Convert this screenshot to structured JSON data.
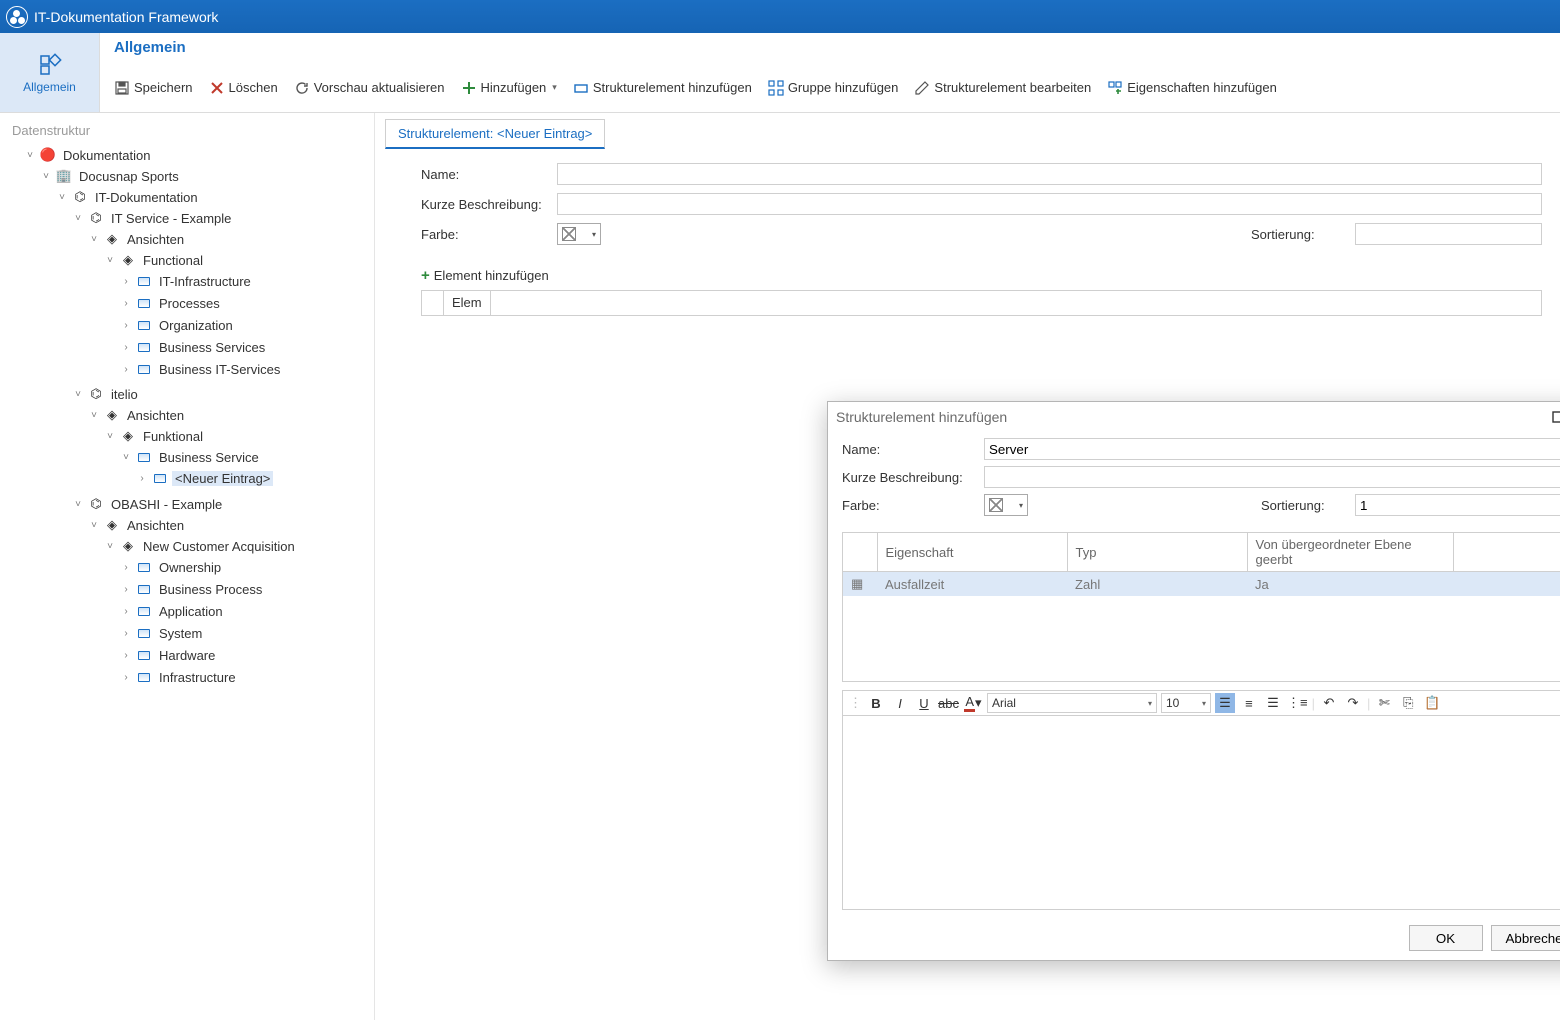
{
  "app": {
    "title": "IT-Dokumentation Framework"
  },
  "ribbon": {
    "tab_button": "Allgemein",
    "group_title": "Allgemein",
    "actions": {
      "save": "Speichern",
      "delete": "Löschen",
      "refresh_preview": "Vorschau aktualisieren",
      "add": "Hinzufügen",
      "add_structure": "Strukturelement hinzufügen",
      "add_group": "Gruppe hinzufügen",
      "edit_structure": "Strukturelement bearbeiten",
      "add_properties": "Eigenschaften hinzufügen"
    }
  },
  "sidebar": {
    "title": "Datenstruktur",
    "nodes": {
      "root": "Dokumentation",
      "company": "Docusnap Sports",
      "itdoc": "IT-Dokumentation",
      "svc_example": "IT Service - Example",
      "views1": "Ansichten",
      "functional": "Functional",
      "it_infra": "IT-Infrastructure",
      "processes": "Processes",
      "organization": "Organization",
      "biz_services": "Business Services",
      "biz_it_services": "Business IT-Services",
      "itelio": "itelio",
      "views2": "Ansichten",
      "funktional": "Funktional",
      "biz_service": "Business Service",
      "new_entry": "<Neuer Eintrag>",
      "obashi": "OBASHI - Example",
      "views3": "Ansichten",
      "nca": "New Customer Acquisition",
      "ownership": "Ownership",
      "biz_process": "Business Process",
      "application": "Application",
      "system": "System",
      "hardware": "Hardware",
      "infrastructure": "Infrastructure"
    }
  },
  "content": {
    "tab": "Strukturelement: <Neuer Eintrag>",
    "labels": {
      "name": "Name:",
      "short_desc": "Kurze Beschreibung:",
      "color": "Farbe:",
      "sort": "Sortierung:"
    },
    "add_element": "Element hinzufügen",
    "grid_head": "Elem"
  },
  "modal": {
    "title": "Strukturelement hinzufügen",
    "labels": {
      "name": "Name:",
      "short_desc": "Kurze Beschreibung:",
      "color": "Farbe:",
      "sort": "Sortierung:"
    },
    "fields": {
      "name": "Server",
      "short_desc": "",
      "sort": "1"
    },
    "table": {
      "headers": {
        "prop": "Eigenschaft",
        "type": "Typ",
        "inherited": "Von übergeordneter Ebene geerbt"
      },
      "rows": [
        {
          "prop": "Ausfallzeit",
          "type": "Zahl",
          "inherited": "Ja"
        }
      ]
    },
    "editor": {
      "font": "Arial",
      "size": "10"
    },
    "buttons": {
      "ok": "OK",
      "cancel": "Abbrechen"
    }
  }
}
